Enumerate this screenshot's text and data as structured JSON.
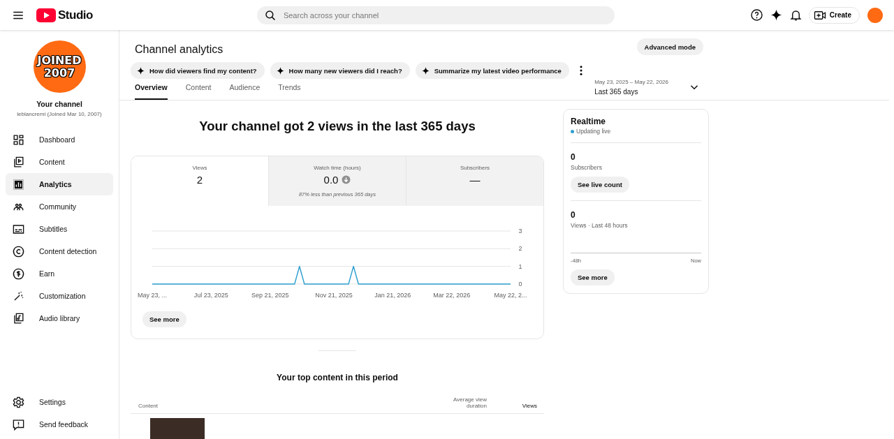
{
  "header": {
    "logo_text": "Studio",
    "search_placeholder": "Search across your channel",
    "create_label": "Create"
  },
  "sidebar": {
    "avatar_lines": [
      "JOINED",
      "2007"
    ],
    "channel_title": "Your channel",
    "channel_subtitle": "leblancremi (Joined Mar 10, 2007)",
    "items": [
      {
        "label": "Dashboard",
        "selected": false
      },
      {
        "label": "Content",
        "selected": false
      },
      {
        "label": "Analytics",
        "selected": true
      },
      {
        "label": "Community",
        "selected": false
      },
      {
        "label": "Subtitles",
        "selected": false
      },
      {
        "label": "Content detection",
        "selected": false
      },
      {
        "label": "Earn",
        "selected": false
      },
      {
        "label": "Customization",
        "selected": false
      },
      {
        "label": "Audio library",
        "selected": false
      }
    ],
    "footer_items": [
      {
        "label": "Settings"
      },
      {
        "label": "Send feedback"
      }
    ]
  },
  "page": {
    "title": "Channel analytics",
    "advanced_button": "Advanced mode",
    "prompts": [
      "How did viewers find my content?",
      "How many new viewers did I reach?",
      "Summarize my latest video performance"
    ],
    "tabs": [
      {
        "label": "Overview",
        "selected": true
      },
      {
        "label": "Content",
        "selected": false
      },
      {
        "label": "Audience",
        "selected": false
      },
      {
        "label": "Trends",
        "selected": false
      }
    ],
    "date_range": {
      "dates": "May 23, 2025 – May 22, 2026",
      "label": "Last 365 days"
    }
  },
  "overview": {
    "headline": "Your channel got 2 views in the last 365 days",
    "metrics": [
      {
        "label": "Views",
        "value": "2",
        "selected": true
      },
      {
        "label": "Watch time (hours)",
        "value": "0.0",
        "note": "87% less than previous 365 days",
        "trend_down": true,
        "selected": false
      },
      {
        "label": "Subscribers",
        "value": "—",
        "selected": false
      }
    ],
    "chart_data": {
      "type": "line",
      "categories": [
        "May 23, ...",
        null,
        null,
        null,
        null,
        null,
        null,
        null,
        null,
        null,
        null,
        null,
        "Jul 23, 2025",
        null,
        null,
        null,
        null,
        null,
        null,
        null,
        null,
        null,
        null,
        null,
        "Sep 21, 2025",
        null,
        null,
        null,
        null,
        null,
        null,
        null,
        null,
        null,
        null,
        null,
        null,
        "Nov 21, 2025",
        null,
        null,
        null,
        null,
        null,
        null,
        null,
        null,
        null,
        null,
        null,
        "Jan 21, 2026",
        null,
        null,
        null,
        null,
        null,
        null,
        null,
        null,
        null,
        null,
        null,
        "Mar 22, 2026",
        null,
        null,
        null,
        null,
        null,
        null,
        null,
        null,
        null,
        null,
        null,
        "May 22, 2..."
      ],
      "series": [
        {
          "color": "#2ea0cf",
          "values": [
            0,
            0,
            0,
            0,
            0,
            0,
            0,
            0,
            0,
            0,
            0,
            0,
            0,
            0,
            0,
            0,
            0,
            0,
            0,
            0,
            0,
            0,
            0,
            0,
            0,
            0,
            0,
            0,
            0,
            0,
            1,
            0,
            0,
            0,
            0,
            0,
            0,
            0,
            0,
            0,
            0,
            1,
            0,
            0,
            0,
            0,
            0,
            0,
            0,
            0,
            0,
            0,
            0,
            0,
            0,
            0,
            0,
            0,
            0,
            0,
            0,
            0,
            0,
            0,
            0,
            0,
            0,
            0,
            0,
            0,
            0,
            0,
            0,
            0
          ]
        }
      ],
      "ylim": [
        0,
        3
      ],
      "yticks": [
        0,
        1,
        2,
        3
      ]
    },
    "see_more": "See more"
  },
  "realtime": {
    "title": "Realtime",
    "status": "Updating live",
    "subscribers_value": "0",
    "subscribers_label": "Subscribers",
    "live_button": "See live count",
    "views_value": "0",
    "views_label": "Views · Last 48 hours",
    "axis_start": "-48h",
    "axis_end": "Now",
    "see_more": "See more"
  },
  "top_content": {
    "title": "Your top content in this period",
    "columns": [
      "Content",
      "Average view duration",
      "Views"
    ]
  }
}
